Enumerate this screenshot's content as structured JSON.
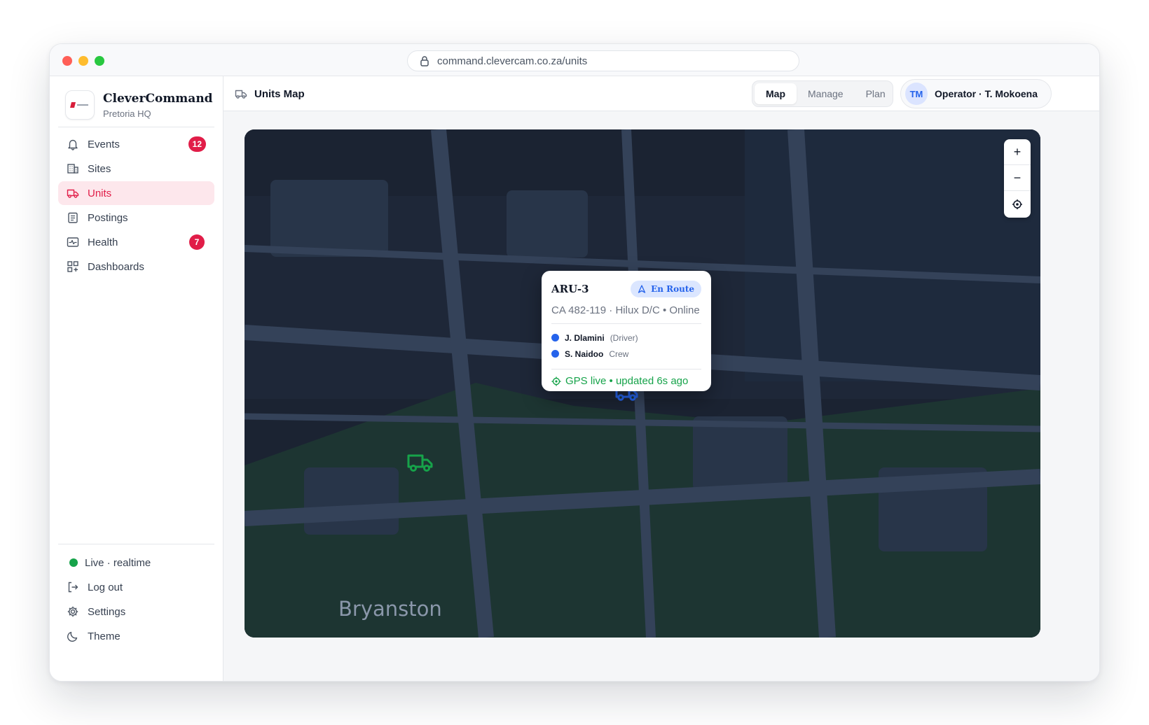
{
  "browser": {
    "url": "command.clevercam.co.za/units"
  },
  "brand": {
    "name": "CleverCommand",
    "subtitle": "Pretoria HQ"
  },
  "sidebar": {
    "items": [
      {
        "label": "Events",
        "icon": "bell-icon",
        "badge": "12"
      },
      {
        "label": "Sites",
        "icon": "building-icon"
      },
      {
        "label": "Units",
        "icon": "truck-icon",
        "active": true
      },
      {
        "label": "Postings",
        "icon": "clipboard-icon"
      },
      {
        "label": "Health",
        "icon": "activity-icon",
        "badge": "7"
      },
      {
        "label": "Dashboards",
        "icon": "dashboard-grid-icon"
      }
    ],
    "bottom": [
      {
        "label": "Live · realtime",
        "icon": "status-dot"
      },
      {
        "label": "Log out",
        "icon": "logout-icon"
      },
      {
        "label": "Settings",
        "icon": "gear-icon"
      },
      {
        "label": "Theme",
        "icon": "moon-icon"
      }
    ]
  },
  "header": {
    "title": "Units Map",
    "tabs": [
      {
        "label": "Map",
        "active": true
      },
      {
        "label": "Manage"
      },
      {
        "label": "Plan"
      }
    ],
    "user": {
      "initials": "TM",
      "name": "Operator · T. Mokoena"
    }
  },
  "map": {
    "area_label": "Bryanston",
    "zoom_in": "+",
    "zoom_out": "−",
    "popup": {
      "unit": "ARU-3",
      "status": "En Route",
      "details": "CA 482-119 · Hilux D/C  •  Online",
      "crew": [
        {
          "name": "J. Dlamini",
          "role": "(Driver)"
        },
        {
          "name": "S. Naidoo",
          "role": "Crew"
        }
      ],
      "gps": "GPS live  •  updated 6s ago"
    }
  },
  "colors": {
    "accent": "#e11d48",
    "primary": "#2563eb",
    "success": "#16a34a",
    "map_bg": "#1b2332"
  }
}
